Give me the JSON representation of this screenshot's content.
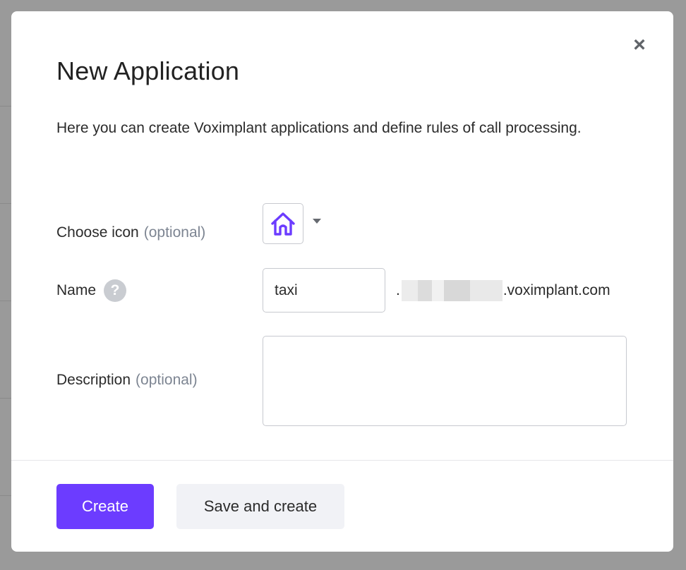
{
  "modal": {
    "title": "New Application",
    "description": "Here you can create Voximplant applications and define rules of call processing.",
    "close_label": "×"
  },
  "form": {
    "icon": {
      "label": "Choose icon",
      "optional": "(optional)",
      "selected_icon": "house-icon"
    },
    "name": {
      "label": "Name",
      "help": "?",
      "value": "taxi",
      "domain_prefix": ".",
      "domain_suffix": ".voximplant.com"
    },
    "description": {
      "label": "Description",
      "optional": "(optional)",
      "value": ""
    }
  },
  "footer": {
    "create_label": "Create",
    "save_create_label": "Save and create"
  },
  "colors": {
    "accent": "#6c3cff",
    "overlay": "#9a9a9a",
    "secondary_button": "#f1f2f6"
  }
}
